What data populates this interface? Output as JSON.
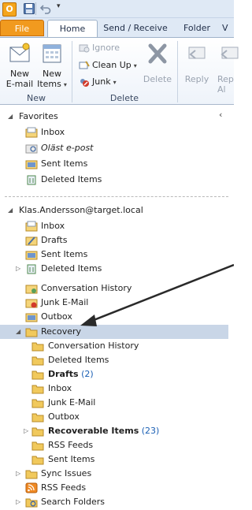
{
  "qat": {
    "logo": "O",
    "more": "▾"
  },
  "tabs": [
    {
      "label": "File"
    },
    {
      "label": "Home"
    },
    {
      "label": "Send / Receive"
    },
    {
      "label": "Folder"
    },
    {
      "label": "V"
    }
  ],
  "ribbon": {
    "new_group": {
      "new_email": "New\nE-mail",
      "new_email_line1": "New",
      "new_email_line2": "E-mail",
      "new_items_line1": "New",
      "new_items_line2": "Items",
      "label": "New"
    },
    "delete_group": {
      "ignore": "Ignore",
      "clean_up": "Clean Up",
      "junk": "Junk",
      "delete": "Delete",
      "label": "Delete"
    },
    "respond_group": {
      "reply": "Reply",
      "reply_all_partial": "Rep",
      "reply_all_partial2": "Al"
    }
  },
  "nav": {
    "favorites": {
      "title": "Favorites",
      "items": [
        {
          "label": "Inbox",
          "icon": "inbox-folder-icon"
        },
        {
          "label": "Oläst e-post",
          "icon": "search-folder-icon"
        },
        {
          "label": "Sent Items",
          "icon": "sent-folder-icon"
        },
        {
          "label": "Deleted Items",
          "icon": "deleted-folder-icon"
        }
      ]
    },
    "account": {
      "title": "Klas.Andersson@target.local",
      "items": [
        {
          "label": "Inbox",
          "icon": "inbox-folder-icon"
        },
        {
          "label": "Drafts",
          "icon": "drafts-folder-icon"
        },
        {
          "label": "Sent Items",
          "icon": "sent-folder-icon"
        },
        {
          "label": "Deleted Items",
          "icon": "deleted-folder-icon"
        },
        {
          "label": "Conversation History",
          "icon": "conversation-folder-icon"
        },
        {
          "label": "Junk E-Mail",
          "icon": "junk-folder-icon"
        },
        {
          "label": "Outbox",
          "icon": "outbox-folder-icon"
        },
        {
          "label": "Recovery",
          "icon": "folder-icon"
        },
        {
          "label": "Conversation History",
          "icon": "folder-icon"
        },
        {
          "label": "Deleted Items",
          "icon": "folder-icon"
        },
        {
          "label": "Drafts",
          "count": "(2)",
          "icon": "folder-icon"
        },
        {
          "label": "Inbox",
          "icon": "folder-icon"
        },
        {
          "label": "Junk E-Mail",
          "icon": "folder-icon"
        },
        {
          "label": "Outbox",
          "icon": "folder-icon"
        },
        {
          "label": "Recoverable Items",
          "count": "(23)",
          "icon": "folder-icon"
        },
        {
          "label": "RSS Feeds",
          "icon": "folder-icon"
        },
        {
          "label": "Sent Items",
          "icon": "folder-icon"
        },
        {
          "label": "Sync Issues",
          "icon": "folder-icon"
        },
        {
          "label": "RSS Feeds",
          "icon": "rss-folder-icon"
        },
        {
          "label": "Search Folders",
          "icon": "search-folder-icon"
        }
      ]
    }
  },
  "colors": {
    "selected_row": "#c9d6e7",
    "file_tab": "#f19a1f",
    "count_blue": "#1a5fb4"
  }
}
